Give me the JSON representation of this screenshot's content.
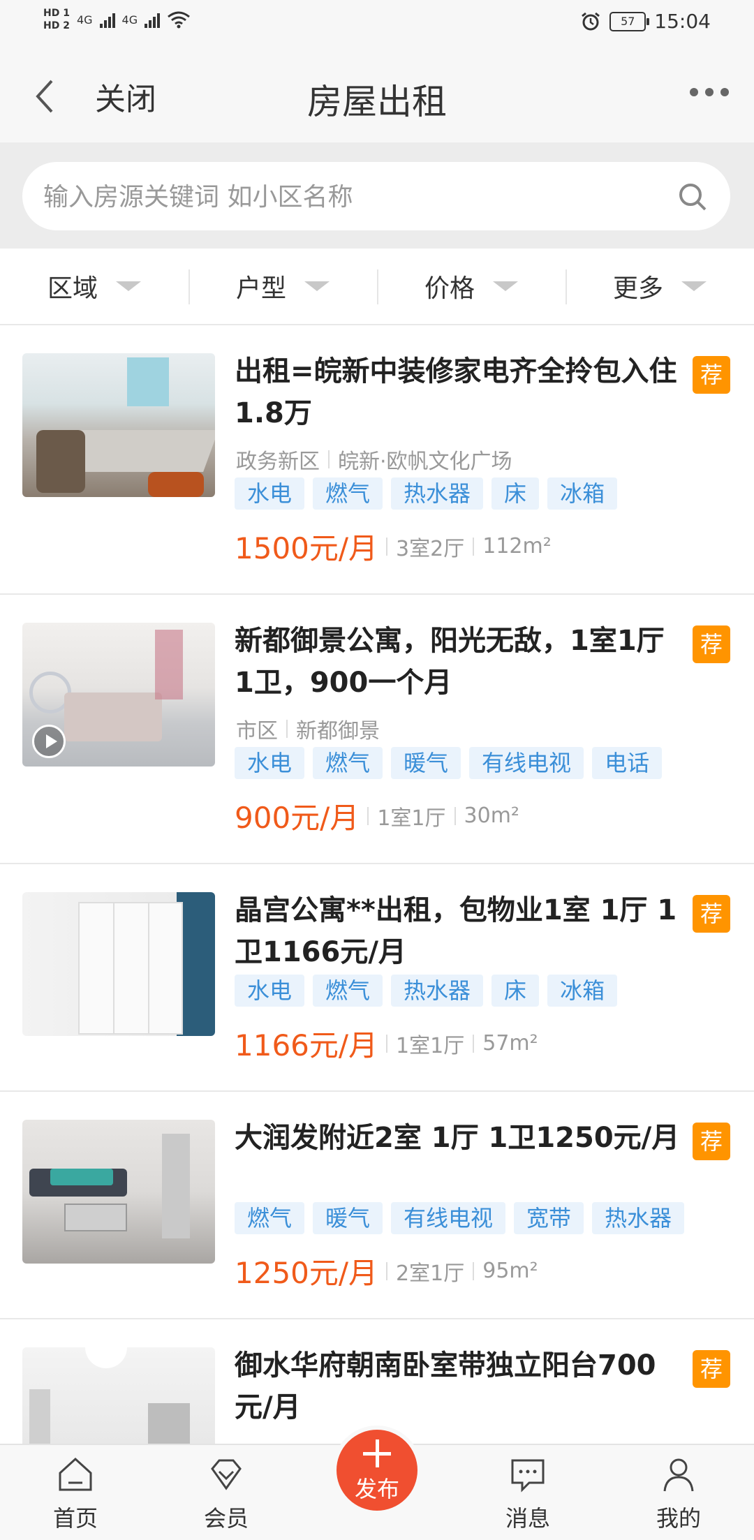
{
  "status_bar": {
    "hd1": "HD 1",
    "hd2": "HD 2",
    "net1": "4G",
    "net2": "4G",
    "battery": "57",
    "time": "15:04"
  },
  "titlebar": {
    "close_label": "关闭",
    "title": "房屋出租"
  },
  "search": {
    "placeholder": "输入房源关键词 如小区名称"
  },
  "filters": [
    {
      "label": "区域"
    },
    {
      "label": "户型"
    },
    {
      "label": "价格"
    },
    {
      "label": "更多"
    }
  ],
  "listings": [
    {
      "title": "出租=皖新中装修家电齐全拎包入住1.8万",
      "badge": "荐",
      "district": "政务新区",
      "community": "皖新·欧帆文化广场",
      "tags": [
        "水电",
        "燃气",
        "热水器",
        "床",
        "冰箱"
      ],
      "price": "1500元/月",
      "layout": "3室2厅",
      "area": "112m²"
    },
    {
      "title": "新都御景公寓，阳光无敌，1室1厅 1卫，900一个月",
      "badge": "荐",
      "district": "市区",
      "community": "新都御景",
      "tags": [
        "水电",
        "燃气",
        "暖气",
        "有线电视",
        "电话"
      ],
      "price": "900元/月",
      "layout": "1室1厅",
      "area": "30m²"
    },
    {
      "title": "晶宫公寓**出租，包物业1室 1厅 1卫1166元/月",
      "badge": "荐",
      "tags": [
        "水电",
        "燃气",
        "热水器",
        "床",
        "冰箱"
      ],
      "price": "1166元/月",
      "layout": "1室1厅",
      "area": "57m²"
    },
    {
      "title": "大润发附近2室 1厅 1卫1250元/月",
      "badge": "荐",
      "tags": [
        "燃气",
        "暖气",
        "有线电视",
        "宽带",
        "热水器"
      ],
      "price": "1250元/月",
      "layout": "2室1厅",
      "area": "95m²"
    },
    {
      "title": "御水华府朝南卧室带独立阳台700元/月",
      "badge": "荐"
    }
  ],
  "bottom_nav": {
    "home": "首页",
    "member": "会员",
    "publish": "发布",
    "messages": "消息",
    "mine": "我的"
  },
  "colors": {
    "accent_orange": "#ff9400",
    "price_red": "#f05a1a",
    "tag_blue": "#3b8fd8",
    "publish_red": "#f04f30"
  }
}
